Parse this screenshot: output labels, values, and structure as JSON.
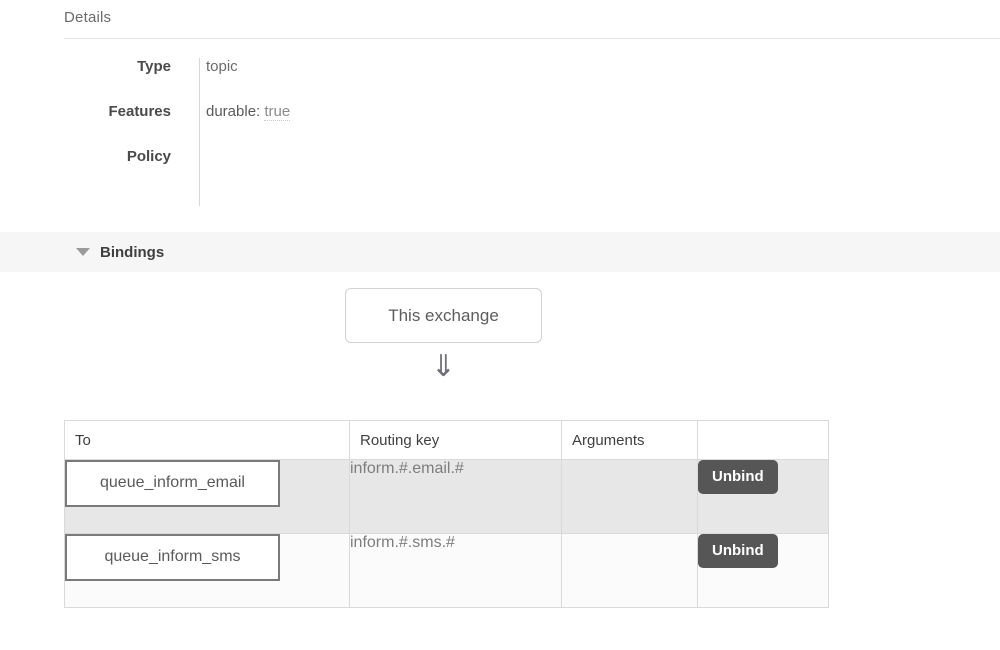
{
  "details": {
    "title": "Details",
    "rows": [
      {
        "label": "Type",
        "value": "topic"
      },
      {
        "label": "Features",
        "feature_key": "durable:",
        "feature_value": "true"
      },
      {
        "label": "Policy",
        "value": ""
      }
    ]
  },
  "bindings": {
    "section_label": "Bindings",
    "collapse_icon": "triangle-down-icon",
    "source_box_label": "This exchange",
    "flow_arrow": "⇓",
    "table": {
      "headers": [
        "To",
        "Routing key",
        "Arguments",
        ""
      ],
      "rows": [
        {
          "to": "queue_inform_email",
          "routing_key": "inform.#.email.#",
          "arguments": "",
          "action_label": "Unbind"
        },
        {
          "to": "queue_inform_sms",
          "routing_key": "inform.#.sms.#",
          "arguments": "",
          "action_label": "Unbind"
        }
      ]
    }
  },
  "colors": {
    "band_background": "#f6f6f6",
    "row_a_background": "#e7e7e7",
    "row_b_background": "#fbfbfb",
    "button_background": "#565656",
    "border": "#d9d9d9"
  }
}
